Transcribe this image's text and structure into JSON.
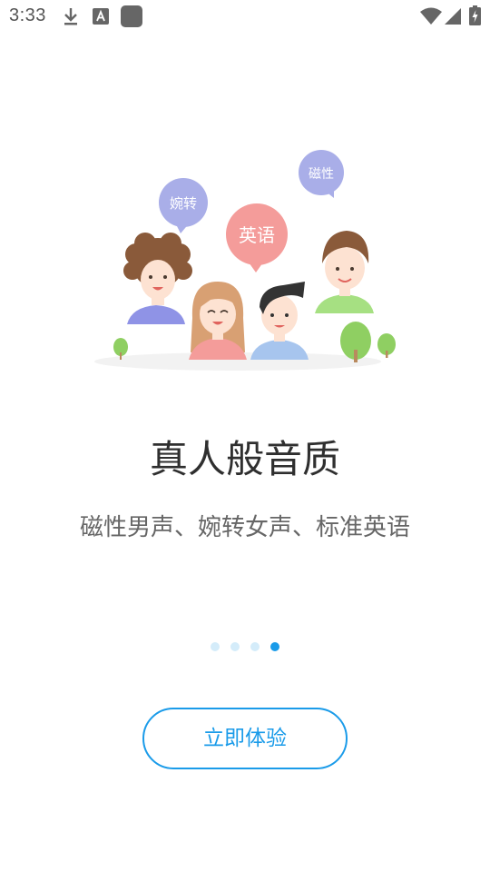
{
  "status_bar": {
    "time": "3:33",
    "icons": [
      "download-icon",
      "font-a-icon",
      "app-square-icon",
      "wifi-icon",
      "signal-icon",
      "battery-charging-icon"
    ]
  },
  "illustration": {
    "bubbles": [
      "婉转",
      "英语",
      "磁性"
    ],
    "colors": {
      "bubble_purple": "#a9aee8",
      "bubble_pink": "#f49c9a",
      "tree_green": "#8fcf62"
    }
  },
  "onboarding": {
    "title": "真人般音质",
    "subtitle": "磁性男声、婉转女声、标准英语",
    "pages_total": 4,
    "current_page": 4,
    "button_label": "立即体验"
  },
  "colors": {
    "accent": "#1a9be9",
    "dot_inactive": "#d4ecfa"
  }
}
